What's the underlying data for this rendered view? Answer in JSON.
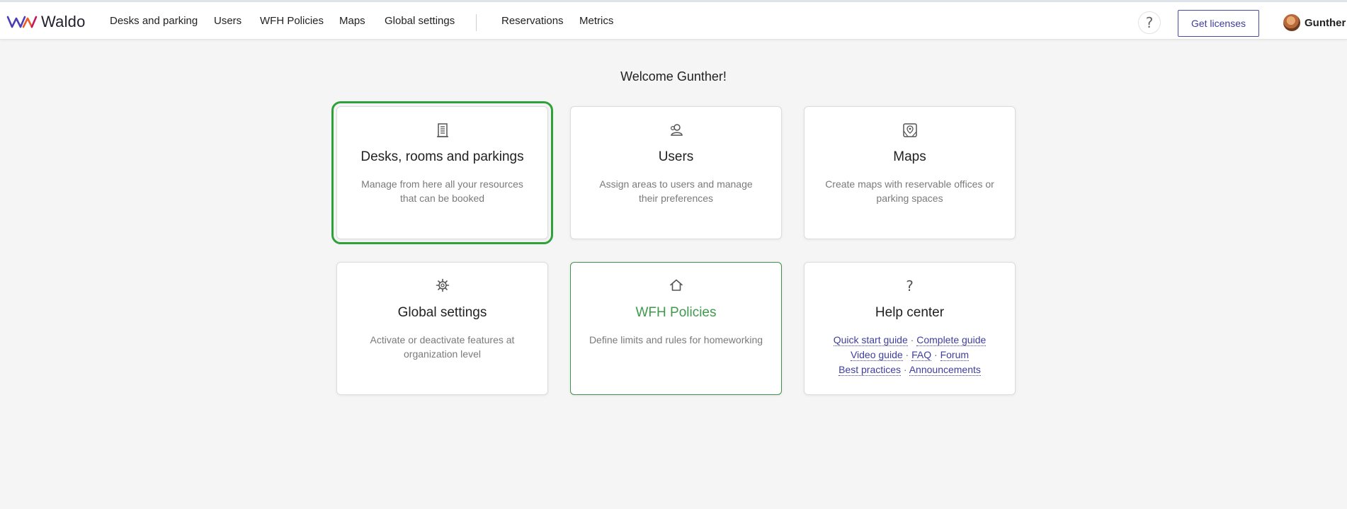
{
  "app": {
    "logo_text": "Waldo"
  },
  "nav": {
    "items": [
      {
        "label": "Desks and parking"
      },
      {
        "label": "Users"
      },
      {
        "label": "WFH Policies"
      },
      {
        "label": "Maps"
      },
      {
        "label": "Global settings"
      },
      {
        "label": "Reservations"
      },
      {
        "label": "Metrics"
      }
    ],
    "help_glyph": "?",
    "get_licenses_label": "Get licenses",
    "user_name": "Gunther"
  },
  "main": {
    "welcome": "Welcome Gunther!",
    "cards": [
      {
        "icon": "building-icon",
        "title": "Desks, rooms and parkings",
        "description": "Manage from here all your resources that can be booked"
      },
      {
        "icon": "user-icon",
        "title": "Users",
        "description": "Assign areas to users and manage their preferences"
      },
      {
        "icon": "map-icon",
        "title": "Maps",
        "description": "Create maps with reservable offices or parking spaces"
      },
      {
        "icon": "gear-icon",
        "title": "Global settings",
        "description": "Activate or deactivate features at organization level"
      },
      {
        "icon": "home-icon",
        "title": "WFH Policies",
        "description": "Define limits and rules for homeworking"
      },
      {
        "icon": "question-icon",
        "title": "Help center",
        "glyph": "?"
      }
    ],
    "help_links": {
      "quick_start": "Quick start guide",
      "complete": "Complete guide",
      "video": "Video guide",
      "faq": "FAQ",
      "forum": "Forum",
      "best_practices": "Best practices",
      "announcements": "Announcements",
      "separator": "·"
    }
  },
  "colors": {
    "accent_green": "#2fa13b",
    "link_blue": "#3e3e9e",
    "logo_purple": "#4b3fb5",
    "logo_orange": "#f05a28"
  }
}
